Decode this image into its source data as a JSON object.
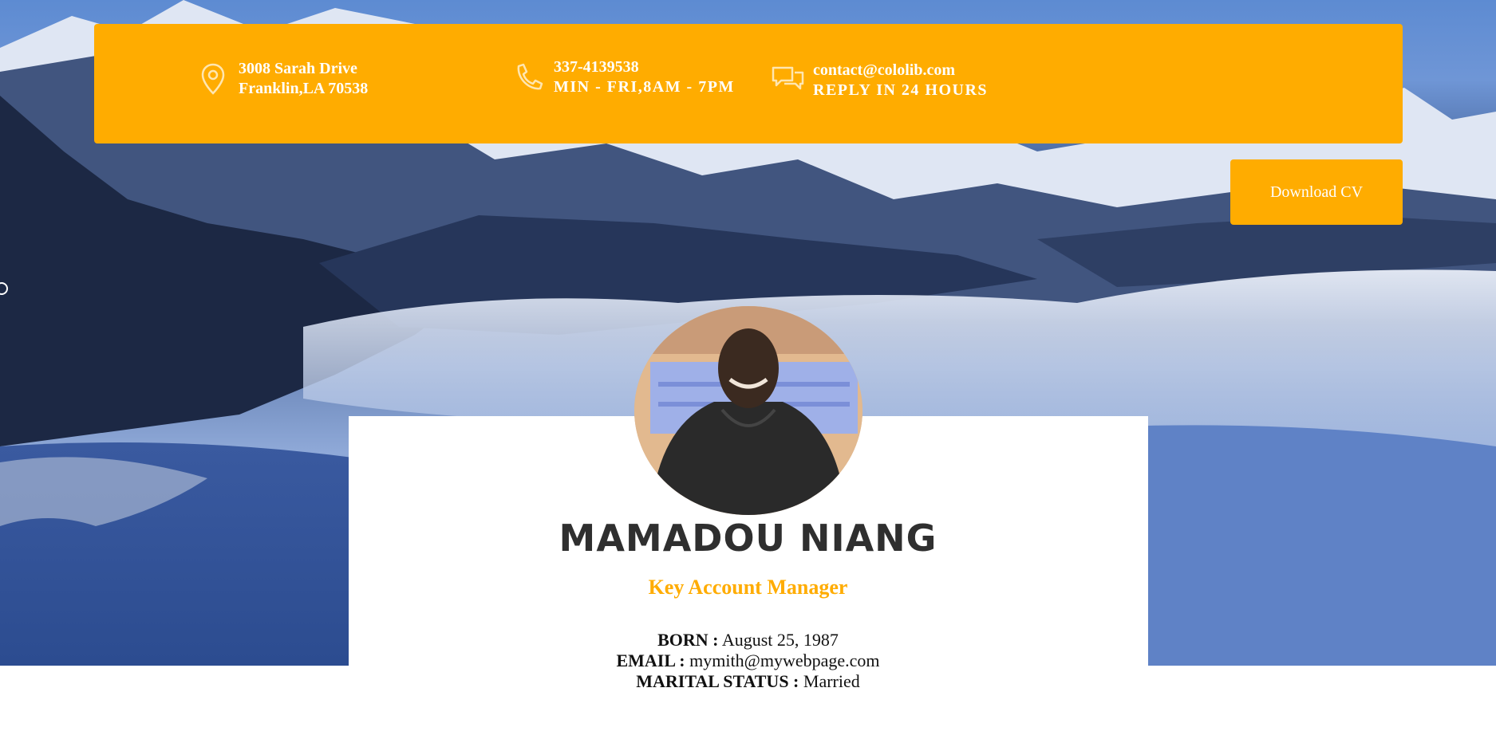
{
  "contact": {
    "address_line1": "3008 Sarah Drive",
    "address_line2": "Franklin,LA 70538",
    "phone_line1": "337-4139538",
    "phone_line2": "MIN - FRI,8AM - 7PM",
    "email_line1": "contact@cololib.com",
    "email_line2": "REPLY IN 24 HOURS",
    "icons": [
      "map-pin-icon",
      "phone-icon",
      "chat-bubbles-icon"
    ]
  },
  "actions": {
    "download_label": "Download CV"
  },
  "profile": {
    "name": "MAMADOU NIANG",
    "role": "Key Account Manager",
    "born_label": "BORN :",
    "born_value": "August 25, 1987",
    "email_label": "EMAIL :",
    "email_value": "mymith@mywebpage.com",
    "marital_label": "MARITAL STATUS :",
    "marital_value": "Married"
  },
  "colors": {
    "accent": "#ffac00",
    "name_text": "#2f2f2f"
  }
}
